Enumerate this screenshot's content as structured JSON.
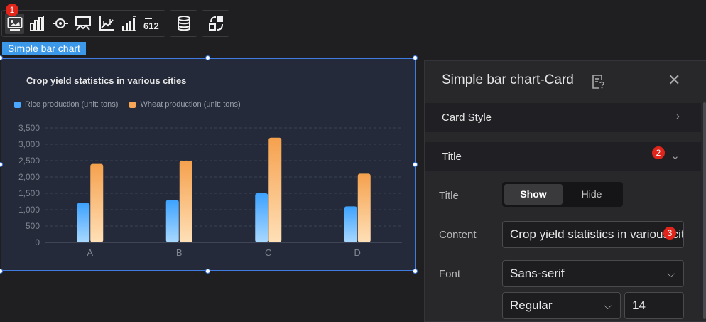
{
  "toolbar": {
    "group1": [
      "image-card-icon",
      "bar-chart-icon",
      "target-icon",
      "map-card-icon",
      "line-chart-icon",
      "step-chart-icon",
      "number-card-icon"
    ],
    "number_icon_text": "612",
    "group2": [
      "database-icon"
    ],
    "group3": [
      "shapes-icon"
    ]
  },
  "badges": {
    "b1": "1",
    "b2": "2",
    "b3": "3"
  },
  "chart_tag": "Simple bar chart",
  "chart_data": {
    "type": "bar",
    "title": "Crop yield statistics in various cities",
    "categories": [
      "A",
      "B",
      "C",
      "D"
    ],
    "series": [
      {
        "name": "Rice production (unit: tons)",
        "values": [
          1200,
          1300,
          1500,
          1100
        ],
        "color": "#4aa8ff"
      },
      {
        "name": "Wheat production (unit: tons)",
        "values": [
          2400,
          2500,
          3200,
          2100
        ],
        "color": "#f7a656"
      }
    ],
    "ylim": [
      0,
      3500
    ],
    "yticks": [
      "0",
      "500",
      "1,000",
      "1,500",
      "2,000",
      "2,500",
      "3,000",
      "3,500"
    ],
    "grid": true,
    "legend": "top-left"
  },
  "panel": {
    "title": "Simple bar chart-Card",
    "sections": {
      "card_style": "Card Style",
      "title": "Title"
    },
    "title_label": "Title",
    "show_label": "Show",
    "hide_label": "Hide",
    "content_label": "Content",
    "content_value": "Crop yield statistics in various cities",
    "font_label": "Font",
    "font_family": "Sans-serif",
    "font_weight": "Regular",
    "font_size": "14"
  }
}
